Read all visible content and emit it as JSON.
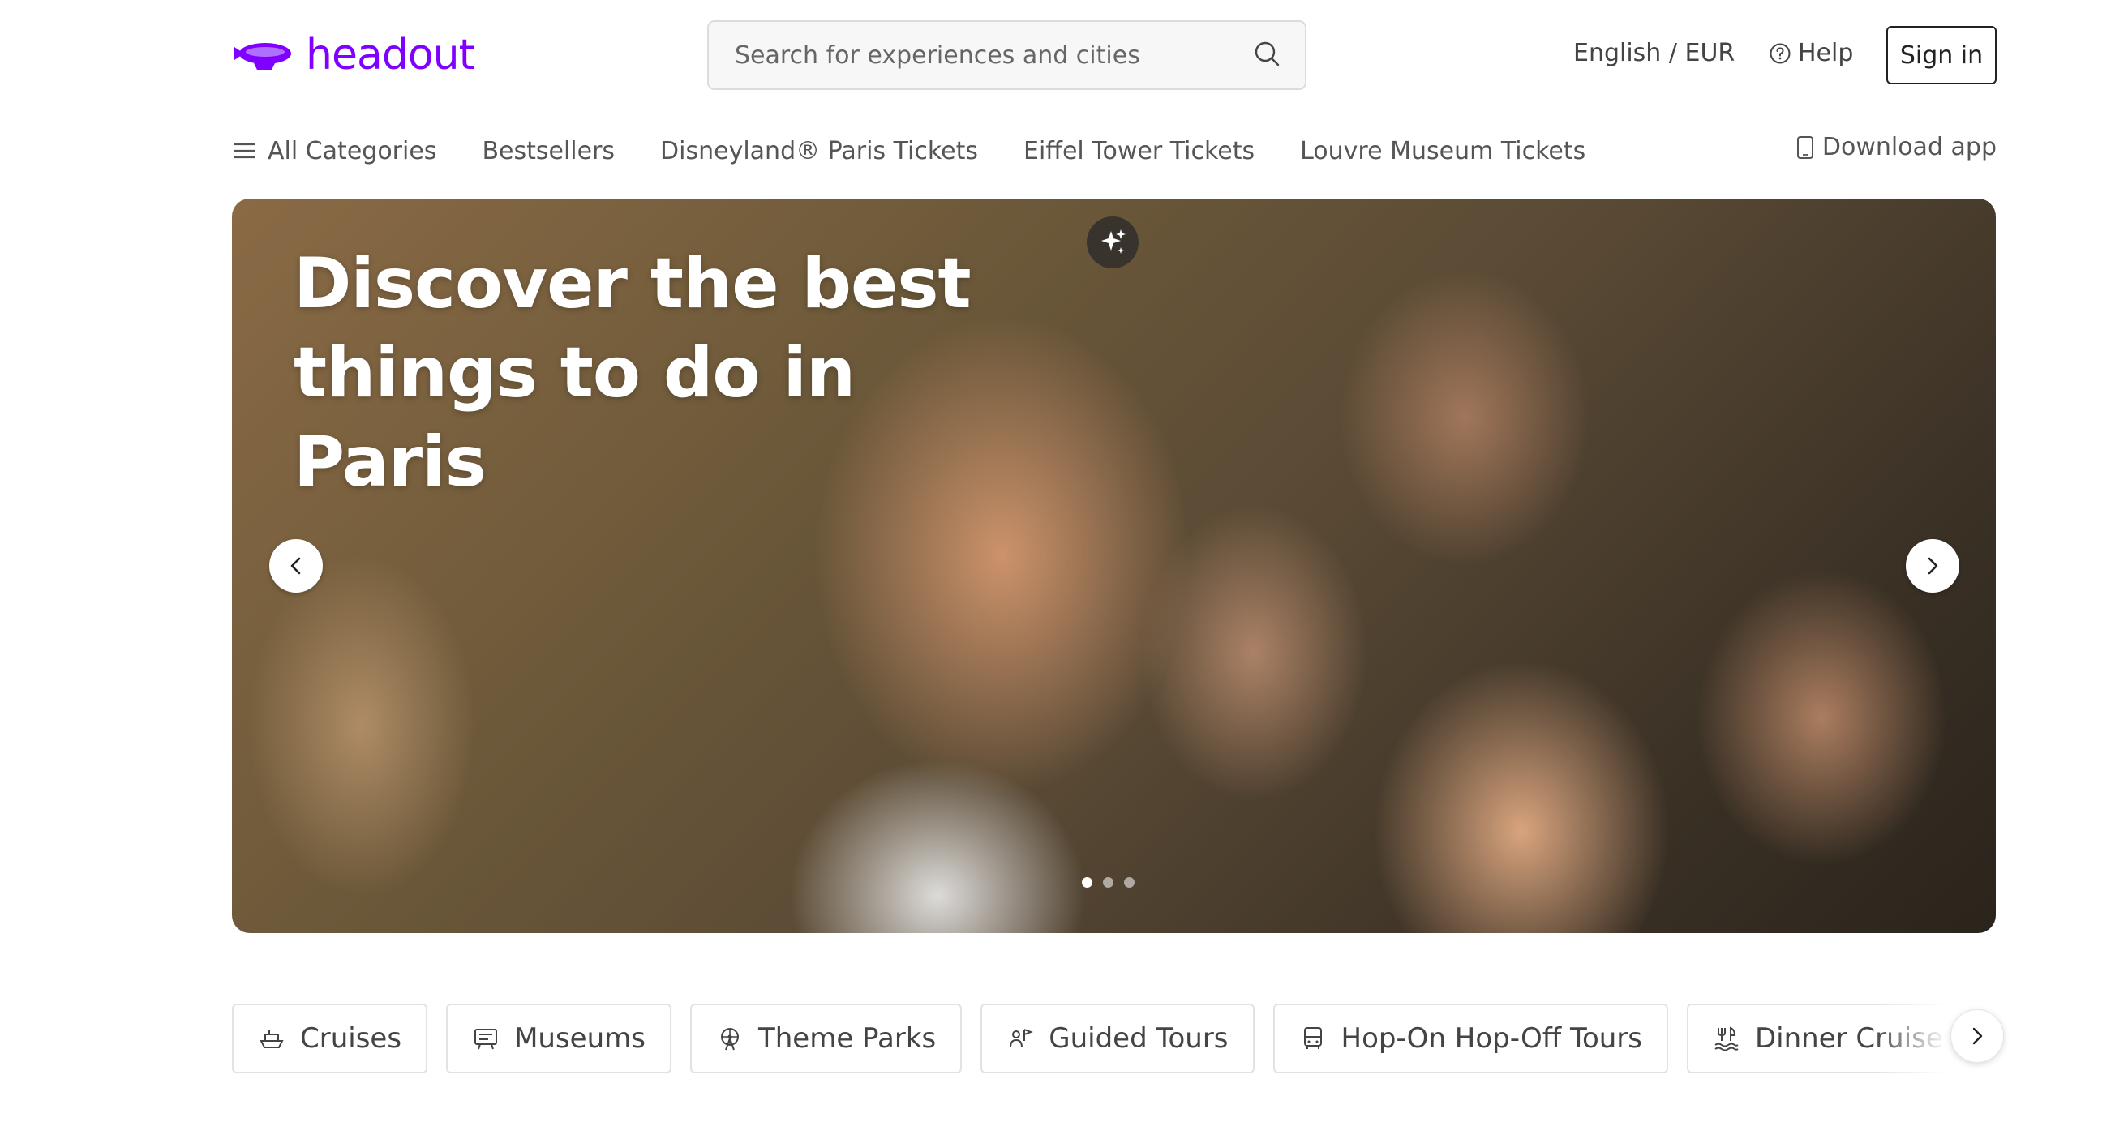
{
  "header": {
    "logo_text": "headout",
    "search_placeholder": "Search for experiences and cities",
    "language_currency": "English / EUR",
    "help_label": "Help",
    "signin_label": "Sign in"
  },
  "nav": {
    "items": [
      {
        "label": "All Categories",
        "icon": "menu-icon"
      },
      {
        "label": "Bestsellers"
      },
      {
        "label": "Disneyland® Paris Tickets"
      },
      {
        "label": "Eiffel Tower Tickets"
      },
      {
        "label": "Louvre Museum Tickets"
      }
    ],
    "download_label": "Download app"
  },
  "hero": {
    "title": "Discover the best things to do in Paris",
    "slide_count": 3,
    "active_slide": 1
  },
  "categories": [
    {
      "label": "Cruises",
      "icon": "cruise-icon"
    },
    {
      "label": "Museums",
      "icon": "museum-icon"
    },
    {
      "label": "Theme Parks",
      "icon": "ferris-wheel-icon"
    },
    {
      "label": "Guided Tours",
      "icon": "guide-icon"
    },
    {
      "label": "Hop-On Hop-Off Tours",
      "icon": "bus-icon"
    },
    {
      "label": "Dinner Cruises",
      "icon": "dining-icon"
    },
    {
      "label": "",
      "icon": "car-icon"
    }
  ],
  "colors": {
    "brand": "#8000ff",
    "text": "#444444",
    "border": "#e2e2e2"
  }
}
